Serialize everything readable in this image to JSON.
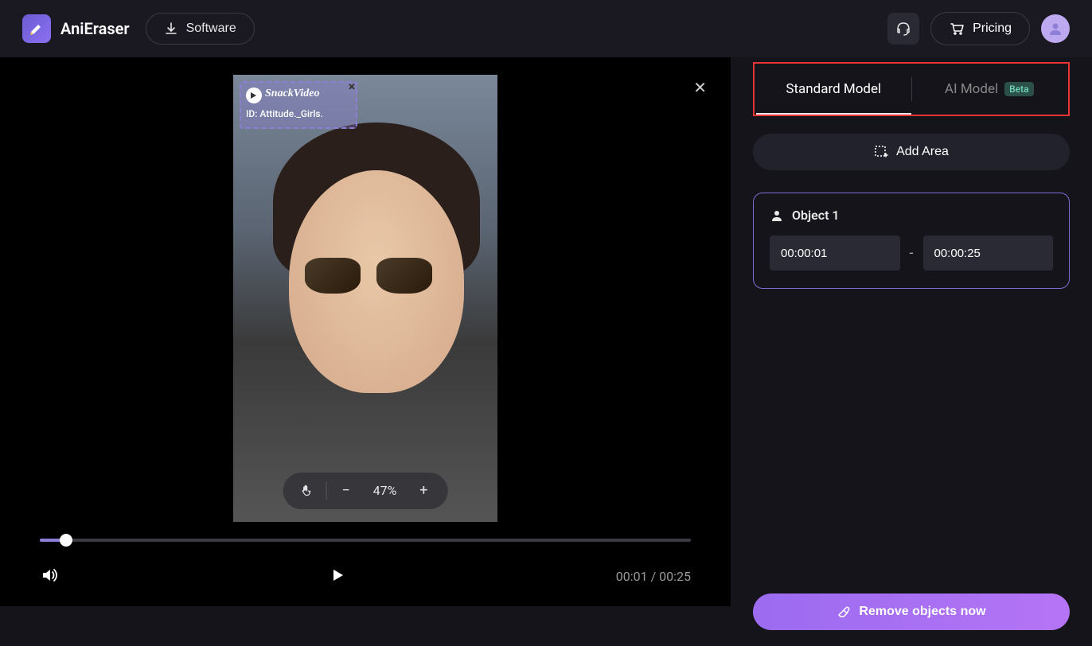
{
  "header": {
    "app_name": "AniEraser",
    "software_label": "Software",
    "pricing_label": "Pricing"
  },
  "video": {
    "watermark_brand": "SnackVideo",
    "watermark_id": "ID: Attitude._Girls.",
    "zoom_percent": "47%",
    "current_time": "00:01",
    "total_time": "00:25",
    "time_separator": " / "
  },
  "panel": {
    "tab_standard": "Standard Model",
    "tab_ai": "AI Model",
    "beta_label": "Beta",
    "add_area_label": "Add Area",
    "object_label": "Object 1",
    "time_start": "00:00:01",
    "time_end": "00:00:25",
    "remove_label": "Remove objects now"
  }
}
